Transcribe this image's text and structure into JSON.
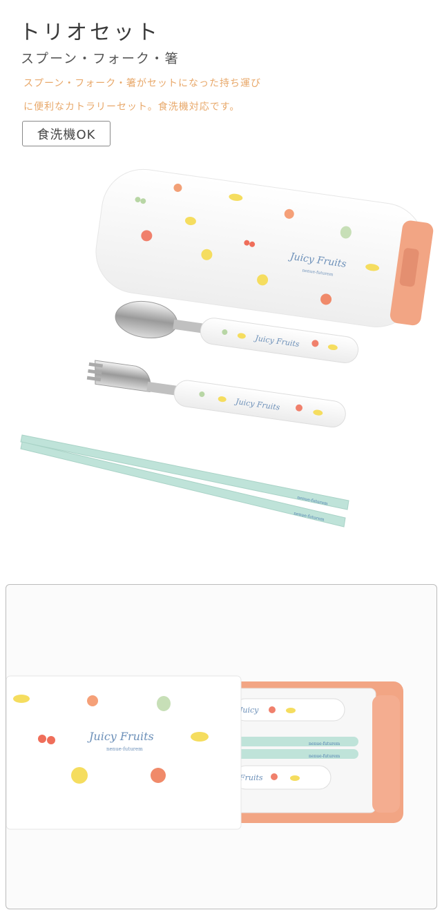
{
  "product": {
    "title": "トリオセット",
    "subtitle": "スプーン・フォーク・箸",
    "description_line1": "スプーン・フォーク・箸がセットになった持ち運び",
    "description_line2": "に便利なカトラリーセット。食洗機対応です。",
    "badge": "食洗機OK"
  },
  "photos": {
    "logo_script": "Juicy Fruits",
    "brand_small": "nenue-futurem",
    "case_color": "#f4a98a",
    "case_body_color": "#ffffff",
    "chopstick_color": "#bfe3d9",
    "label_accent": "#e8a86a"
  }
}
